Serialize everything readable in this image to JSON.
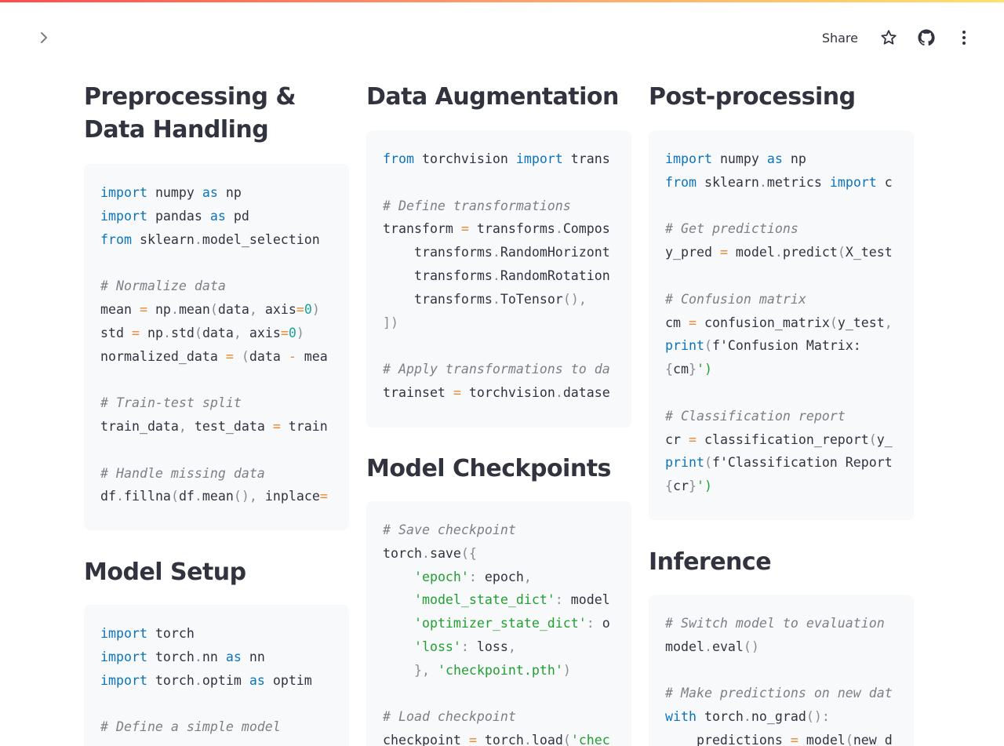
{
  "toolbar": {
    "share_label": "Share"
  },
  "icons": {
    "sidebar_toggle": "chevron-right-icon",
    "star": "star-icon",
    "github": "github-icon",
    "menu": "kebab-menu-icon"
  },
  "colors": {
    "keyword": "#0b74bd",
    "comment": "#7d7f86",
    "operator": "#e8872e",
    "number": "#1aa39a",
    "string": "#21a031",
    "code_background": "#f8f9fb"
  },
  "sections": {
    "preprocessing": {
      "title": "Preprocessing & Data Handling",
      "lines": [
        "import numpy as np",
        "import pandas as pd",
        "from sklearn.model_selection",
        "",
        "# Normalize data",
        "mean = np.mean(data, axis=0)",
        "std = np.std(data, axis=0)",
        "normalized_data = (data - mea",
        "",
        "# Train-test split",
        "train_data, test_data = train",
        "",
        "# Handle missing data",
        "df.fillna(df.mean(), inplace="
      ]
    },
    "model_setup": {
      "title": "Model Setup",
      "lines": [
        "import torch",
        "import torch.nn as nn",
        "import torch.optim as optim",
        "",
        "# Define a simple model"
      ]
    },
    "augmentation": {
      "title": "Data Augmentation",
      "lines": [
        "from torchvision import trans",
        "",
        "# Define transformations",
        "transform = transforms.Compos",
        "    transforms.RandomHorizont",
        "    transforms.RandomRotation",
        "    transforms.ToTensor(),",
        "])",
        "",
        "# Apply transformations to da",
        "trainset = torchvision.datase"
      ]
    },
    "checkpoints": {
      "title": "Model Checkpoints",
      "lines": [
        "# Save checkpoint",
        "torch.save({",
        "    'epoch': epoch,",
        "    'model_state_dict': model",
        "    'optimizer_state_dict': o",
        "    'loss': loss,",
        "    }, 'checkpoint.pth')",
        "",
        "# Load checkpoint",
        "checkpoint = torch.load('chec"
      ]
    },
    "postprocessing": {
      "title": "Post-processing",
      "lines": [
        "import numpy as np",
        "from sklearn.metrics import c",
        "",
        "# Get predictions",
        "y_pred = model.predict(X_test",
        "",
        "# Confusion matrix",
        "cm = confusion_matrix(y_test,",
        "print(f'Confusion Matrix:",
        "{cm}')",
        "",
        "# Classification report",
        "cr = classification_report(y_",
        "print(f'Classification Report",
        "{cr}')"
      ]
    },
    "inference": {
      "title": "Inference",
      "lines": [
        "# Switch model to evaluation",
        "model.eval()",
        "",
        "# Make predictions on new dat",
        "with torch.no_grad():",
        "    predictions = model(new d"
      ]
    }
  }
}
